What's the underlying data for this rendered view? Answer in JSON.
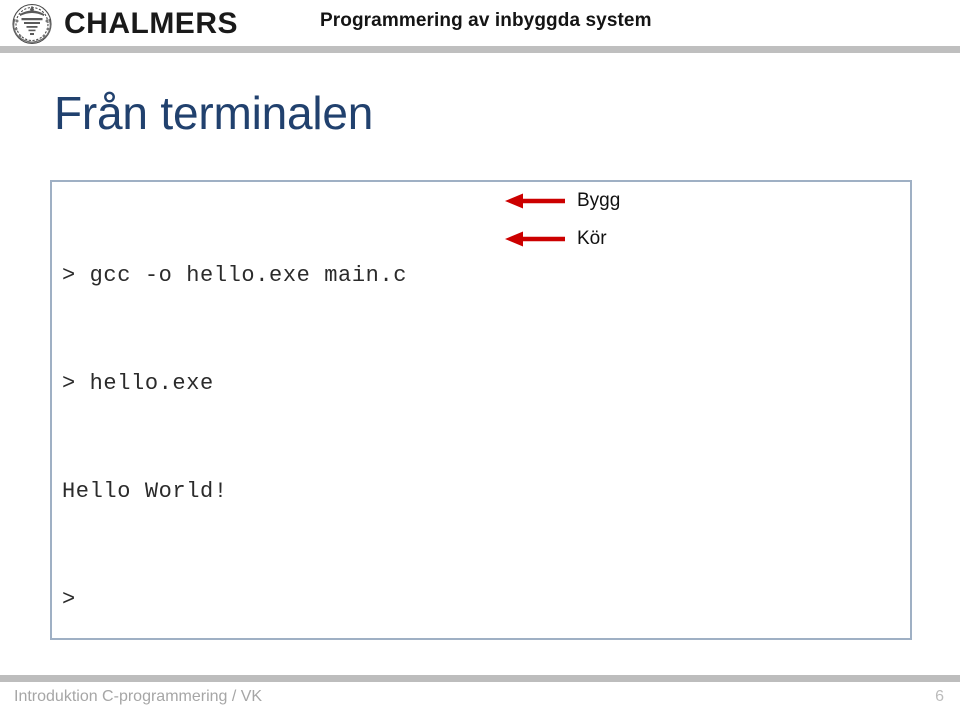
{
  "header": {
    "logo_wordmark": "CHALMERS",
    "logo_emblem_icon": "chalmers-crest-icon",
    "course_title": "Programmering av inbyggda system"
  },
  "slide": {
    "title": "Från terminalen",
    "title_color": "#21416e"
  },
  "terminal": {
    "lines": [
      "> gcc -o hello.exe main.c",
      "> hello.exe",
      "Hello World!",
      ">"
    ],
    "text_color": "#2b2b2b"
  },
  "annotations": [
    {
      "arrow_icon": "arrow-left-icon",
      "arrow_color": "#cc0000",
      "label": "Bygg"
    },
    {
      "arrow_icon": "arrow-left-icon",
      "arrow_color": "#cc0000",
      "label": "Kör"
    }
  ],
  "footer": {
    "text": "Introduktion C-programmering / VK",
    "page_number": "6"
  }
}
